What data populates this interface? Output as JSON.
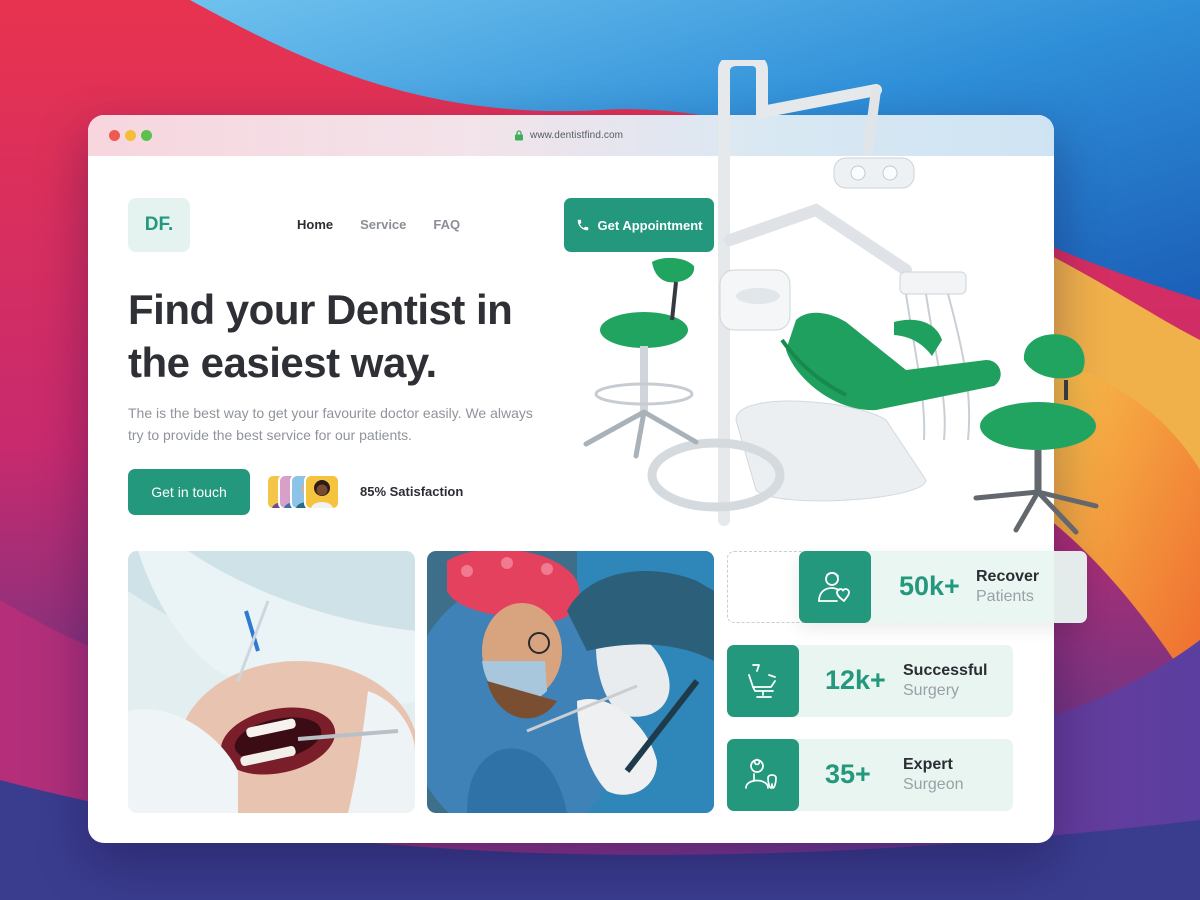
{
  "browser": {
    "url": "www.dentistfind.com",
    "lock_icon": "lock-icon"
  },
  "header": {
    "logo_text": "DF.",
    "nav": [
      {
        "label": "Home",
        "active": true
      },
      {
        "label": "Service",
        "active": false
      },
      {
        "label": "FAQ",
        "active": false
      }
    ],
    "cta_label": "Get Appointment",
    "cta_icon": "phone-icon"
  },
  "hero": {
    "title_line1": "Find your Dentist in",
    "title_line2": "the easiest way.",
    "subtitle": "The is the best way to get your favourite doctor easily. We always try to provide the best service for our patients.",
    "button_label": "Get in touch",
    "satisfaction": "85% Satisfaction"
  },
  "stats": [
    {
      "value": "50k+",
      "label_strong": "Recover",
      "label_muted": "Patients",
      "icon": "patient-heart-icon"
    },
    {
      "value": "12k+",
      "label_strong": "Successful",
      "label_muted": "Surgery",
      "icon": "dental-chair-icon"
    },
    {
      "value": "35+",
      "label_strong": "Expert",
      "label_muted": "Surgeon",
      "icon": "surgeon-tooth-icon"
    }
  ],
  "colors": {
    "accent": "#24987c",
    "accent_light": "#e9f5f1",
    "heading": "#2e3036",
    "muted": "#8f949b"
  }
}
